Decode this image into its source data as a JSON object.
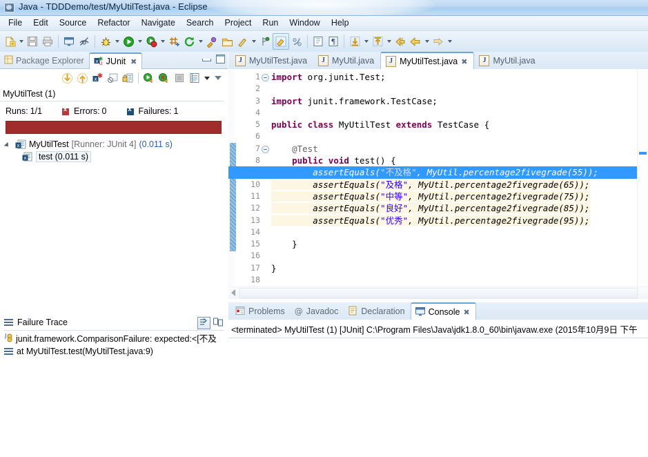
{
  "window": {
    "title": "Java - TDDDemo/test/MyUtilTest.java - Eclipse",
    "icon": "eclipse-icon"
  },
  "menubar": {
    "items": [
      {
        "label": "File"
      },
      {
        "label": "Edit"
      },
      {
        "label": "Source"
      },
      {
        "label": "Refactor"
      },
      {
        "label": "Navigate"
      },
      {
        "label": "Search"
      },
      {
        "label": "Project"
      },
      {
        "label": "Run"
      },
      {
        "label": "Window"
      },
      {
        "label": "Help"
      }
    ]
  },
  "toolbar": {
    "icons": [
      "new-wizard-icon",
      "save-icon",
      "print-icon",
      "toggle-console-icon",
      "toggle-mark-occurrences-icon",
      "debug-icon",
      "run-icon",
      "coverage-icon",
      "new-java-package-icon",
      "external-tools-icon",
      "open-type-icon",
      "open-task-icon",
      "search-icon",
      "annotation-icon",
      "java-perspective-icon",
      "java-browsing-icon",
      "toggle-block-selection-icon",
      "show-whitespace-icon",
      "previous-annotation-icon",
      "next-annotation-icon",
      "back-icon",
      "forward-icon"
    ]
  },
  "left_pane": {
    "tabs": [
      {
        "label": "Package Explorer",
        "icon": "package-explorer-icon",
        "active": false,
        "closable": false
      },
      {
        "label": "JUnit",
        "icon": "junit-icon",
        "active": true,
        "closable": true
      }
    ],
    "view_controls": [
      "minimize-view",
      "maximize-view"
    ],
    "junit_toolbar_icons": [
      "next-failure-icon",
      "previous-failure-icon",
      "show-failures-only-icon",
      "stop-icon",
      "lock-scroll-icon",
      "rerun-test-icon",
      "rerun-failed-tests-icon",
      "stop-junit-icon",
      "test-history-icon",
      "history-dropdown",
      "view-menu"
    ],
    "run_name": "MyUtilTest (1)",
    "counters": {
      "runs_label": "Runs:",
      "runs_value": "1/1",
      "errors_label": "Errors:",
      "errors_value": "0",
      "failures_label": "Failures:",
      "failures_value": "1"
    },
    "progress_color": "#a02c2c",
    "tree": [
      {
        "name": "MyUtilTest",
        "runner": "[Runner: JUnit 4]",
        "time": "(0.011 s)",
        "icon": "test-class-failed-icon",
        "expanded": true,
        "selected": false
      },
      {
        "name": "test (0.011 s)",
        "runner": "",
        "time": "",
        "icon": "test-method-failed-icon",
        "expanded": false,
        "selected": true
      }
    ],
    "failure_trace": {
      "title": "Failure Trace",
      "controls": [
        "filter-stack-trace-icon",
        "compare-result-icon"
      ],
      "rows": [
        {
          "icon": "exception-icon",
          "text": "junit.framework.ComparisonFailure: expected:<[不及"
        },
        {
          "icon": "stackframe-icon",
          "text": "at MyUtilTest.test(MyUtilTest.java:9)"
        }
      ]
    }
  },
  "editor": {
    "tabs": [
      {
        "label": "MyUtilTest.java",
        "icon": "java-file-icon",
        "active": false,
        "closable": false
      },
      {
        "label": "MyUtil.java",
        "icon": "java-file-icon",
        "active": false,
        "closable": false
      },
      {
        "label": "MyUtilTest.java",
        "icon": "java-file-icon",
        "active": true,
        "closable": true
      },
      {
        "label": "MyUtil.java",
        "icon": "java-file-icon",
        "active": false,
        "closable": false
      }
    ],
    "highlighted_line": 9,
    "line_numbers": [
      "1",
      "2",
      "3",
      "4",
      "5",
      "6",
      "7",
      "8",
      "9",
      "10",
      "11",
      "12",
      "13",
      "14",
      "15",
      "16",
      "17",
      "18"
    ],
    "fold_lines": [
      1,
      7
    ],
    "code_lines": [
      "import org.junit.Test;",
      "",
      "import junit.framework.TestCase;",
      "",
      "public class MyUtilTest extends TestCase {",
      "",
      "    @Test",
      "    public void test() {",
      "        assertEquals(\"不及格\", MyUtil.percentage2fivegrade(55));",
      "        assertEquals(\"及格\", MyUtil.percentage2fivegrade(65));",
      "        assertEquals(\"中等\", MyUtil.percentage2fivegrade(75));",
      "        assertEquals(\"良好\", MyUtil.percentage2fivegrade(85));",
      "        assertEquals(\"优秀\", MyUtil.percentage2fivegrade(95));",
      "",
      "    }",
      "",
      "}",
      ""
    ]
  },
  "console": {
    "tabs": [
      {
        "label": "Problems",
        "icon": "problems-icon",
        "active": false,
        "closable": false
      },
      {
        "label": "Javadoc",
        "icon": "javadoc-icon",
        "active": false,
        "closable": false
      },
      {
        "label": "Declaration",
        "icon": "declaration-icon",
        "active": false,
        "closable": false
      },
      {
        "label": "Console",
        "icon": "console-icon",
        "active": true,
        "closable": true
      }
    ],
    "output": "<terminated> MyUtilTest (1) [JUnit] C:\\Program Files\\Java\\jdk1.8.0_60\\bin\\javaw.exe (2015年10月9日 下午"
  },
  "colors": {
    "title_bar": "#bdd8f2",
    "tab_active_top": "#6ba3d6",
    "failure_red": "#a02c2c",
    "selection_blue": "#3399ff",
    "keyword": "#7f0055",
    "string": "#2a00ff"
  }
}
